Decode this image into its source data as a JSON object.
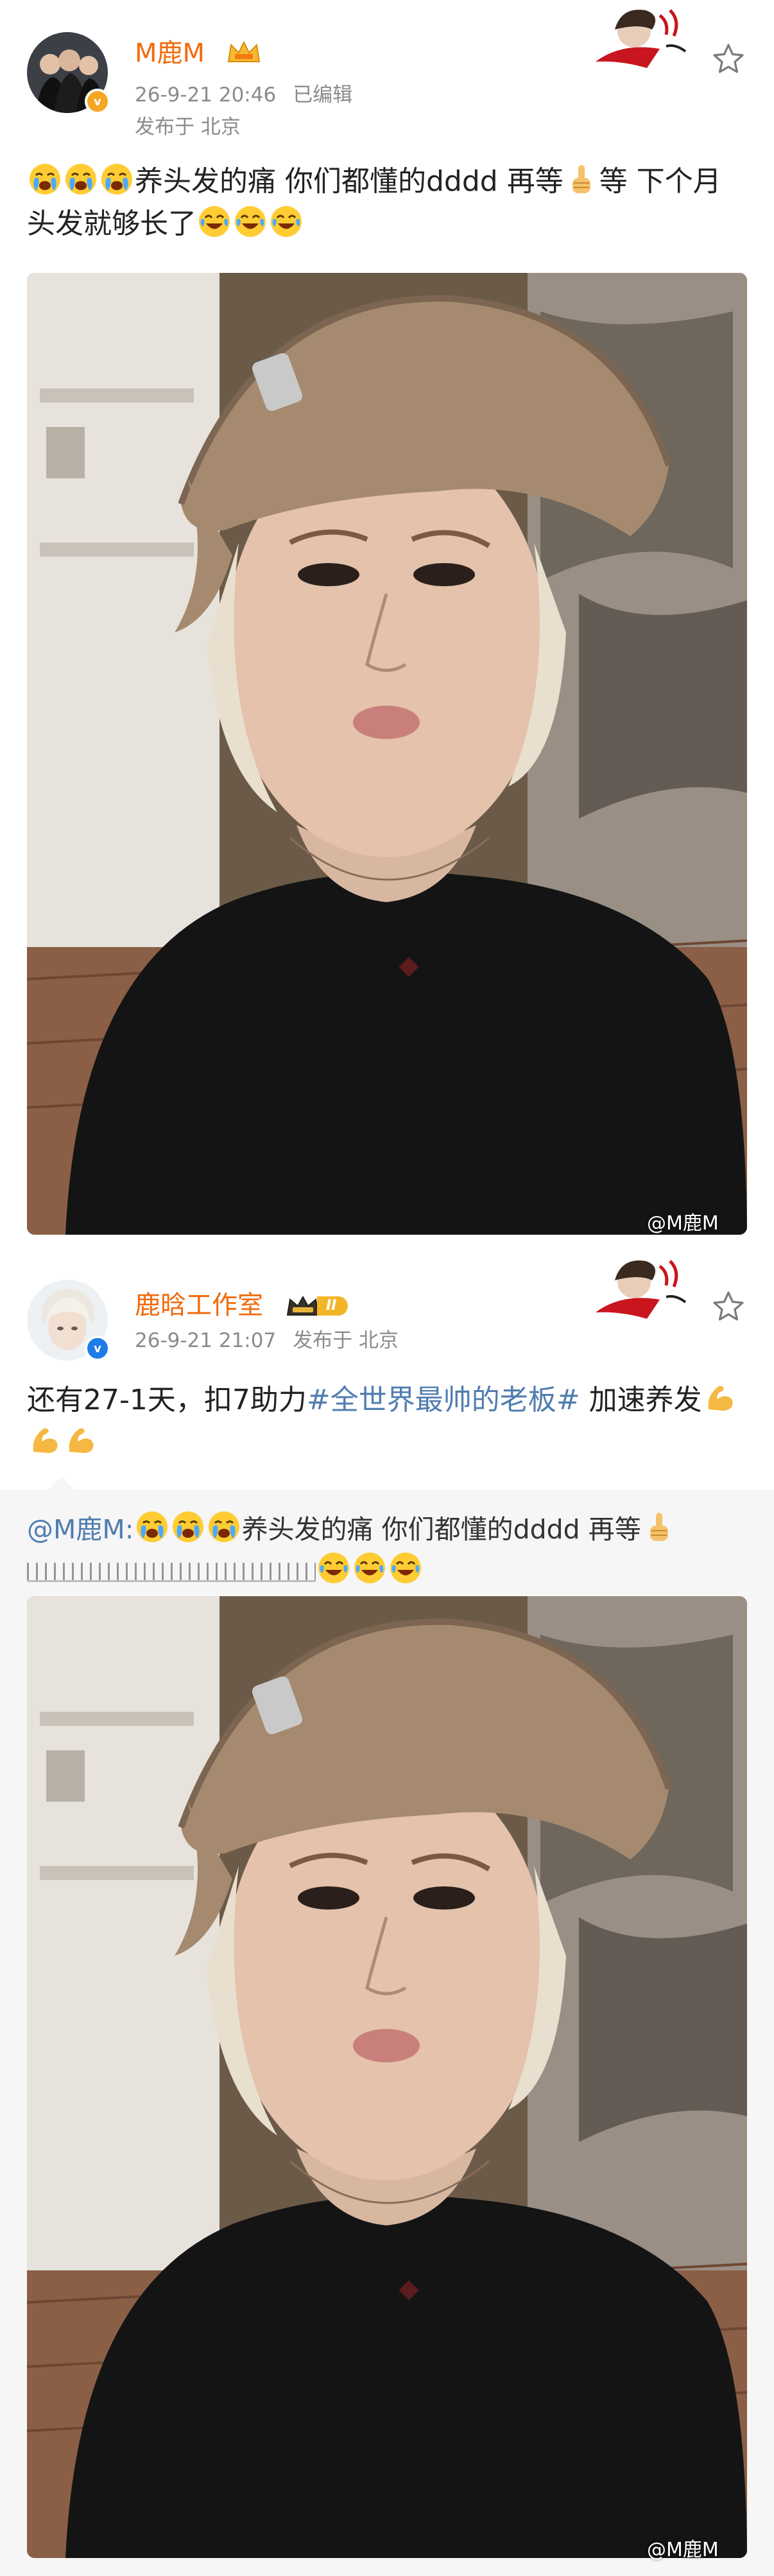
{
  "post1": {
    "user_name": "M鹿M",
    "timestamp": "26-9-21 20:46",
    "edited_label": "已编辑",
    "location_label": "发布于 北京",
    "text_part1": "养头发的痛 你们都懂的dddd 再等",
    "text_part2": "等 下个月头发就够长了",
    "watermark": "@M鹿M"
  },
  "post2": {
    "user_name": "鹿晗工作室",
    "rank_badge": "II",
    "timestamp": "26-9-21 21:07",
    "location_label": "发布于 北京",
    "text_part1": "还有27-1天，扣7助力",
    "topic": "#全世界最帅的老板#",
    "text_part2": " 加速养发",
    "repost_mention": "@M鹿M:",
    "repost_text": "养头发的痛 你们都懂的dddd 再等",
    "watermark": "@M鹿M"
  },
  "icons": {
    "verified_badge": "verified-badge-icon",
    "more": "star-icon",
    "emoji_crying": "loudly-crying-emoji",
    "emoji_laughing": "tears-of-joy-emoji",
    "emoji_pointing": "index-pointing-up-emoji",
    "emoji_muscle": "flexed-biceps-emoji"
  },
  "colors": {
    "username": "#f06b0c",
    "meta": "#8b8b8b",
    "topic_link": "#507daf",
    "repost_bg": "#f6f6f6"
  }
}
